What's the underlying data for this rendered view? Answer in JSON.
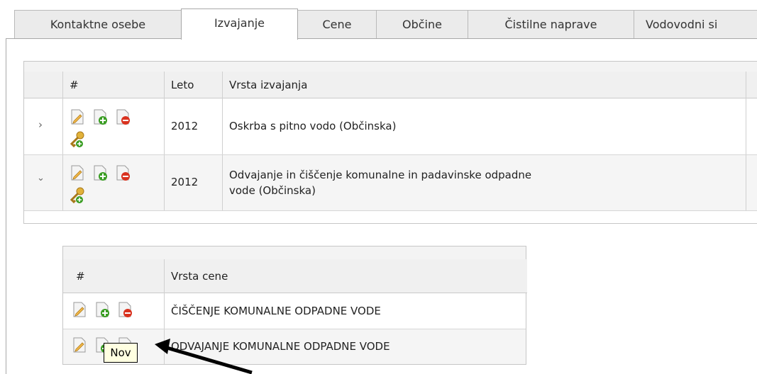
{
  "tabs": [
    {
      "label": "Kontaktne osebe"
    },
    {
      "label": "Izvajanje"
    },
    {
      "label": "Cene"
    },
    {
      "label": "Občine"
    },
    {
      "label": "Čistilne naprave"
    },
    {
      "label": "Vodovodni si"
    }
  ],
  "main_grid": {
    "headers": {
      "hash": "#",
      "leto": "Leto",
      "vrsta": "Vrsta izvajanja"
    },
    "rows": [
      {
        "leto": "2012",
        "vrsta_line1": "Oskrba s pitno vodo (Občinska)",
        "vrsta_line2": ""
      },
      {
        "leto": "2012",
        "vrsta_line1": "Odvajanje in čiščenje komunalne in padavinske odpadne",
        "vrsta_line2": "vode (Občinska)"
      }
    ]
  },
  "sub_grid": {
    "headers": {
      "hash": "#",
      "vrsta_cene": "Vrsta cene"
    },
    "rows": [
      {
        "vrsta_cene": "ČIŠČENJE KOMUNALNE ODPADNE VODE"
      },
      {
        "vrsta_cene": "ODVAJANJE KOMUNALNE ODPADNE VODE"
      }
    ]
  },
  "tooltip": {
    "text": "Nov"
  },
  "icons": {
    "expand": "chevron-right-icon",
    "collapse": "chevron-down-icon",
    "edit": "edit-document-icon",
    "add": "add-document-icon",
    "delete": "delete-document-icon",
    "key_add": "key-add-icon"
  },
  "colors": {
    "green": "#3a9d23",
    "red": "#d9321f",
    "tooltip_bg": "#ffffe1"
  }
}
